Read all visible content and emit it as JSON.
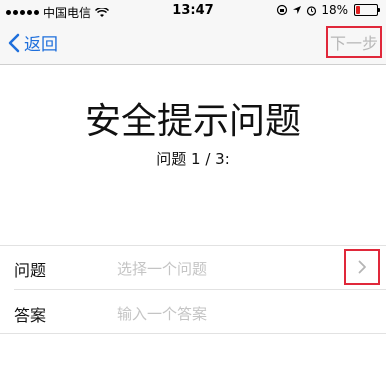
{
  "status_bar": {
    "carrier": "中国电信",
    "time": "13:47",
    "battery_text": "18%",
    "battery_level": 0.18,
    "battery_color": "#e02020"
  },
  "nav": {
    "back_label": "返回",
    "next_label": "下一步",
    "accent_color": "#1e6fdc"
  },
  "main": {
    "title": "安全提示问题",
    "subtitle": "问题 1 / 3:"
  },
  "form": {
    "rows": [
      {
        "label": "问题",
        "placeholder": "选择一个问题",
        "icon": "chevron-right-icon"
      },
      {
        "label": "答案",
        "placeholder": "输入一个答案"
      }
    ]
  }
}
